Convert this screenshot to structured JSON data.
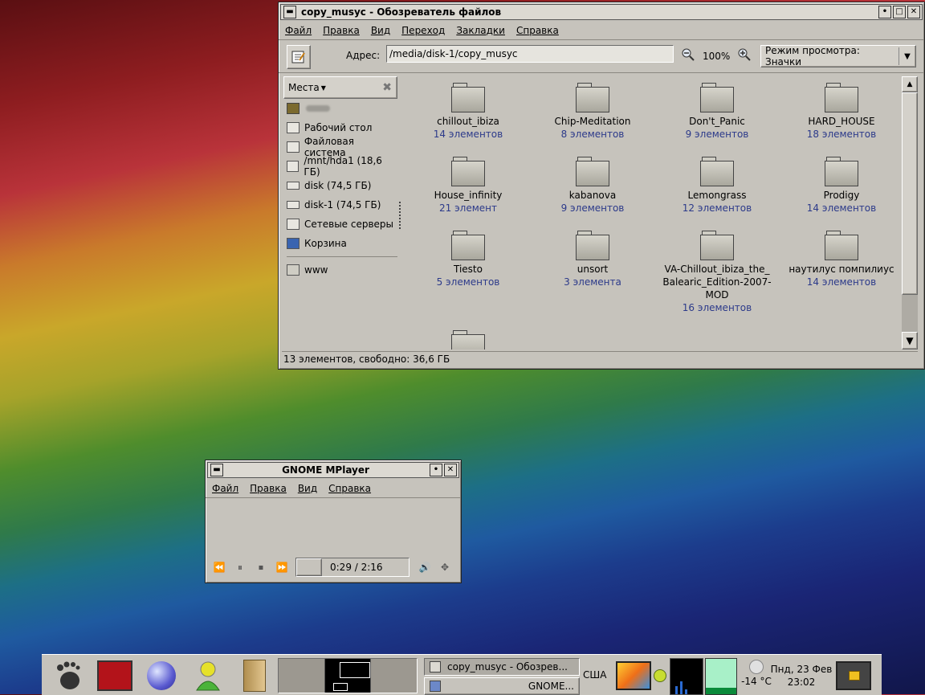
{
  "file_browser": {
    "title": "copy_musyc - Обозреватель файлов",
    "menu": [
      "Файл",
      "Правка",
      "Вид",
      "Переход",
      "Закладки",
      "Справка"
    ],
    "address_label": "Адрес:",
    "address_value": "/media/disk-1/copy_musyc",
    "zoom": "100%",
    "view_mode": "Режим просмотра: Значки",
    "places_label": "Места",
    "places": [
      {
        "label": "Рабочий стол",
        "icon": "desktop-icon"
      },
      {
        "label": "Файловая система",
        "icon": "drive-icon"
      },
      {
        "label": "/mnt/hda1 (18,6 ГБ)",
        "icon": "drive-icon"
      },
      {
        "label": "disk (74,5 ГБ)",
        "icon": "disk-icon"
      },
      {
        "label": "disk-1 (74,5 ГБ)",
        "icon": "disk-icon"
      },
      {
        "label": "Сетевые серверы",
        "icon": "network-icon"
      },
      {
        "label": "Корзина",
        "icon": "trash-icon"
      }
    ],
    "bookmarks": [
      {
        "label": "www",
        "icon": "folder-icon"
      }
    ],
    "folders": [
      {
        "name": "chillout_ibiza",
        "count": "14 элементов"
      },
      {
        "name": "Chip-Meditation",
        "count": "8 элементов"
      },
      {
        "name": "Don't_Panic",
        "count": "9 элементов"
      },
      {
        "name": "HARD_HOUSE",
        "count": "18 элементов"
      },
      {
        "name": "House_infinity",
        "count": "21 элемент"
      },
      {
        "name": "kabanova",
        "count": "9 элементов"
      },
      {
        "name": "Lemongrass",
        "count": "12 элементов"
      },
      {
        "name": "Prodigy",
        "count": "14 элементов"
      },
      {
        "name": "Tiesto",
        "count": "5 элементов"
      },
      {
        "name": "unsort",
        "count": "3 элемента"
      },
      {
        "name": "VA-Chillout_ibiza_the_Balearic_Edition-2007-MOD",
        "name_lines": [
          "VA-Chillout_ibiza_the_",
          "Balearic_Edition-2007-",
          "MOD"
        ],
        "count": "16 элементов"
      },
      {
        "name": "наутилус помпилиус",
        "count": "14 элементов"
      }
    ],
    "status": "13 элементов, свободно: 36,6 ГБ"
  },
  "mplayer": {
    "title": "GNOME MPlayer",
    "menu": [
      "Файл",
      "Правка",
      "Вид",
      "Справка"
    ],
    "time": "0:29 /  2:16"
  },
  "taskbar": {
    "tasks": [
      {
        "label": "copy_musyc - Обозрев...",
        "icon": "file-manager-icon"
      },
      {
        "label": "GNOME...",
        "icon": "mplayer-icon"
      }
    ],
    "keyboard_layout": "США",
    "temperature": "-14 °C",
    "date": "Пнд, 23 Фев",
    "time": "23:02"
  },
  "colors": {
    "window_bg": "#c6c3bc",
    "count_text": "#2c3a8a"
  }
}
